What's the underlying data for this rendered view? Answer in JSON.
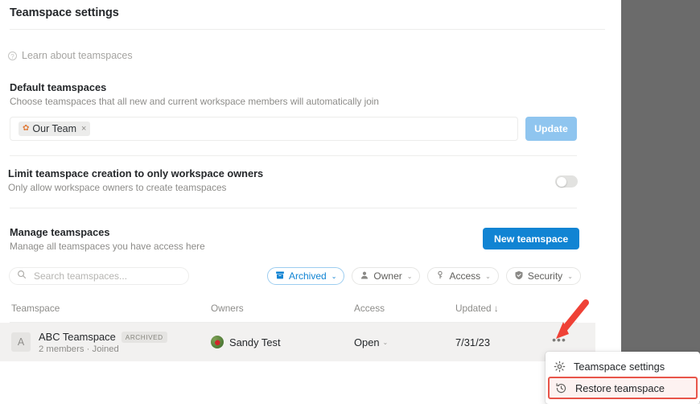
{
  "header": {
    "title": "Teamspace settings"
  },
  "learn": {
    "icon": "question-circle-icon",
    "label": "Learn about teamspaces"
  },
  "default_teamspaces": {
    "title": "Default teamspaces",
    "subtitle": "Choose teamspaces that all new and current workspace members will automatically join",
    "chips": [
      {
        "emoji": "✿",
        "label": "Our Team",
        "remove": "×"
      }
    ],
    "update_button": "Update"
  },
  "limit_creation": {
    "title": "Limit teamspace creation to only workspace owners",
    "subtitle": "Only allow workspace owners to create teamspaces",
    "toggle_state": "off"
  },
  "manage": {
    "title": "Manage teamspaces",
    "subtitle": "Manage all teamspaces you have access here",
    "new_button": "New teamspace"
  },
  "search": {
    "placeholder": "Search teamspaces...",
    "value": "",
    "icon": "search-icon"
  },
  "filters": [
    {
      "label": "Archived",
      "icon": "archive-box-icon",
      "active": true,
      "caret": "⌄"
    },
    {
      "label": "Owner",
      "icon": "person-icon",
      "active": false,
      "caret": "⌄"
    },
    {
      "label": "Access",
      "icon": "key-icon",
      "active": false,
      "caret": "⌄"
    },
    {
      "label": "Security",
      "icon": "shield-check-icon",
      "active": false,
      "caret": "⌄"
    }
  ],
  "table": {
    "columns": {
      "teamspace": "Teamspace",
      "owners": "Owners",
      "access": "Access",
      "updated": "Updated ↓"
    },
    "rows": [
      {
        "avatar_letter": "A",
        "name": "ABC Teamspace",
        "badge": "ARCHIVED",
        "meta": "2 members · Joined",
        "owner": "Sandy Test",
        "access": "Open",
        "access_caret": "⌄",
        "updated": "7/31/23",
        "more_label": "•••"
      }
    ]
  },
  "context_menu": {
    "items": [
      {
        "label": "Teamspace settings",
        "icon": "gear-icon",
        "highlighted": false
      },
      {
        "label": "Restore teamspace",
        "icon": "clock-restore-icon",
        "highlighted": true
      }
    ]
  },
  "annotations": {
    "arrow_color": "#ef4136",
    "highlight_color": "#e8554a"
  }
}
